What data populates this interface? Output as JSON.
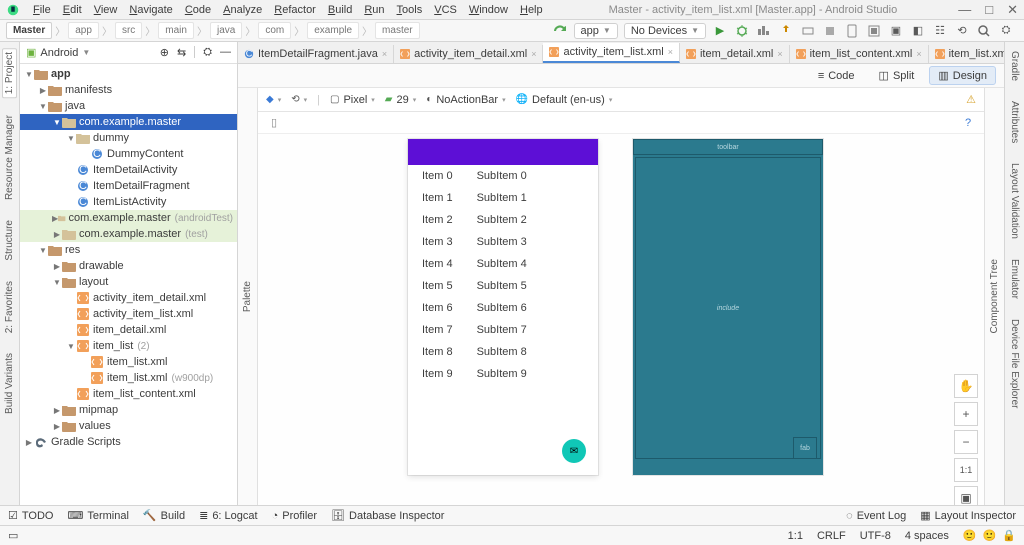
{
  "title": "Master - activity_item_list.xml [Master.app] - Android Studio",
  "menus": [
    "File",
    "Edit",
    "View",
    "Navigate",
    "Code",
    "Analyze",
    "Refactor",
    "Build",
    "Run",
    "Tools",
    "VCS",
    "Window",
    "Help"
  ],
  "crumbs": [
    "Master",
    "app",
    "src",
    "main",
    "java",
    "com",
    "example",
    "master"
  ],
  "run_config": {
    "app": "app",
    "device": "No Devices"
  },
  "project_dropdown": "Android",
  "tree": [
    {
      "lvl": 0,
      "arrow": "▼",
      "type": "mod",
      "label": "app",
      "bold": true
    },
    {
      "lvl": 1,
      "arrow": "▶",
      "type": "fold",
      "label": "manifests"
    },
    {
      "lvl": 1,
      "arrow": "▼",
      "type": "fold",
      "label": "java"
    },
    {
      "lvl": 2,
      "arrow": "▼",
      "type": "pkg",
      "label": "com.example.master",
      "sel": true
    },
    {
      "lvl": 3,
      "arrow": "▼",
      "type": "pkg",
      "label": "dummy"
    },
    {
      "lvl": 4,
      "arrow": "",
      "type": "cls",
      "label": "DummyContent"
    },
    {
      "lvl": 3,
      "arrow": "",
      "type": "cls",
      "label": "ItemDetailActivity"
    },
    {
      "lvl": 3,
      "arrow": "",
      "type": "cls",
      "label": "ItemDetailFragment"
    },
    {
      "lvl": 3,
      "arrow": "",
      "type": "cls",
      "label": "ItemListActivity"
    },
    {
      "lvl": 2,
      "arrow": "▶",
      "type": "pkg",
      "label": "com.example.master",
      "suffix": "(androidTest)",
      "hint": true
    },
    {
      "lvl": 2,
      "arrow": "▶",
      "type": "pkg",
      "label": "com.example.master",
      "suffix": "(test)",
      "hint": true
    },
    {
      "lvl": 1,
      "arrow": "▼",
      "type": "fold",
      "label": "res"
    },
    {
      "lvl": 2,
      "arrow": "▶",
      "type": "fold",
      "label": "drawable"
    },
    {
      "lvl": 2,
      "arrow": "▼",
      "type": "fold",
      "label": "layout"
    },
    {
      "lvl": 3,
      "arrow": "",
      "type": "xml",
      "label": "activity_item_detail.xml"
    },
    {
      "lvl": 3,
      "arrow": "",
      "type": "xml",
      "label": "activity_item_list.xml"
    },
    {
      "lvl": 3,
      "arrow": "",
      "type": "xml",
      "label": "item_detail.xml"
    },
    {
      "lvl": 3,
      "arrow": "▼",
      "type": "xfold",
      "label": "item_list",
      "suffix": "(2)"
    },
    {
      "lvl": 4,
      "arrow": "",
      "type": "xml",
      "label": "item_list.xml"
    },
    {
      "lvl": 4,
      "arrow": "",
      "type": "xml",
      "label": "item_list.xml",
      "suffix": "(w900dp)"
    },
    {
      "lvl": 3,
      "arrow": "",
      "type": "xml",
      "label": "item_list_content.xml"
    },
    {
      "lvl": 2,
      "arrow": "▶",
      "type": "fold",
      "label": "mipmap"
    },
    {
      "lvl": 2,
      "arrow": "▶",
      "type": "fold",
      "label": "values"
    },
    {
      "lvl": 0,
      "arrow": "▶",
      "type": "gradle",
      "label": "Gradle Scripts"
    }
  ],
  "tabs": [
    {
      "icon": "java",
      "label": "ItemDetailFragment.java"
    },
    {
      "icon": "xml",
      "label": "activity_item_detail.xml"
    },
    {
      "icon": "xml",
      "label": "activity_item_list.xml",
      "active": true
    },
    {
      "icon": "xml",
      "label": "item_detail.xml"
    },
    {
      "icon": "xml",
      "label": "item_list_content.xml"
    },
    {
      "icon": "xml",
      "label": "item_list.xml"
    }
  ],
  "view_modes": {
    "code": "Code",
    "split": "Split",
    "design": "Design",
    "active": "Design"
  },
  "devbar": {
    "device": "Pixel",
    "api": "29",
    "theme": "NoActionBar",
    "locale": "Default (en-us)"
  },
  "preview_items": [
    {
      "a": "Item 0",
      "b": "SubItem 0"
    },
    {
      "a": "Item 1",
      "b": "SubItem 1"
    },
    {
      "a": "Item 2",
      "b": "SubItem 2"
    },
    {
      "a": "Item 3",
      "b": "SubItem 3"
    },
    {
      "a": "Item 4",
      "b": "SubItem 4"
    },
    {
      "a": "Item 5",
      "b": "SubItem 5"
    },
    {
      "a": "Item 6",
      "b": "SubItem 6"
    },
    {
      "a": "Item 7",
      "b": "SubItem 7"
    },
    {
      "a": "Item 8",
      "b": "SubItem 8"
    },
    {
      "a": "Item 9",
      "b": "SubItem 9"
    }
  ],
  "blueprint": {
    "top": "toolbar",
    "mid": "include",
    "fab": "fab"
  },
  "left_tabs": [
    "1: Project",
    "Resource Manager",
    "Structure",
    "2: Favorites",
    "Build Variants"
  ],
  "right_tabs": [
    "Gradle",
    "Attributes",
    "Layout Validation",
    "Emulator",
    "Device File Explorer"
  ],
  "palette_tabs": [
    "Palette",
    "Component Tree"
  ],
  "bottom_tabs": [
    "TODO",
    "Terminal",
    "Build",
    "6: Logcat",
    "Profiler",
    "Database Inspector"
  ],
  "bottom_right": [
    "Event Log",
    "Layout Inspector"
  ],
  "status": {
    "pos": "1:1",
    "enc": "CRLF",
    "charset": "UTF-8",
    "indent": "4 spaces"
  },
  "zoom": {
    "one": "1:1"
  }
}
